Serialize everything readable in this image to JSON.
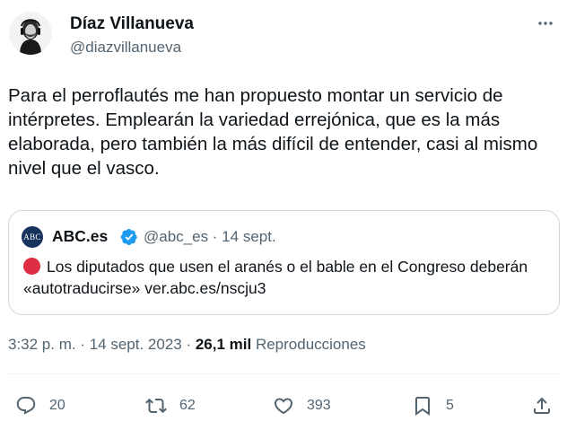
{
  "author": {
    "name": "Díaz Villanueva",
    "handle": "@diazvillanueva",
    "avatar_icon": "avatar-portrait"
  },
  "tweet": {
    "text": "Para el perroflautés me han propuesto montar un servicio de intérpretes. Emplearán la variedad errejónica, que es la más elaborada, pero también la más difícil de entender, casi al mismo nivel que el vasco."
  },
  "quoted": {
    "logo_text": "ABC",
    "name": "ABC.es",
    "handle_date": "@abc_es · 14 sept.",
    "verified_icon": "verified-badge-icon",
    "text": "Los diputados que usen el aranés o el bable en el Congreso deberán «autotraducirse» ver.abc.es/nscju3",
    "emoji_color": "#dd2e44"
  },
  "meta": {
    "timestamp": "3:32 p. m. · 14 sept. 2023 · ",
    "views_count": "26,1 mil",
    "views_label": " Reproducciones"
  },
  "actions": {
    "replies": "20",
    "reposts": "62",
    "likes": "393",
    "bookmarks": "5"
  },
  "colors": {
    "primary_text": "#0f1419",
    "secondary_text": "#536471",
    "border": "#cfd9de",
    "verified": "#1d9bf0"
  }
}
